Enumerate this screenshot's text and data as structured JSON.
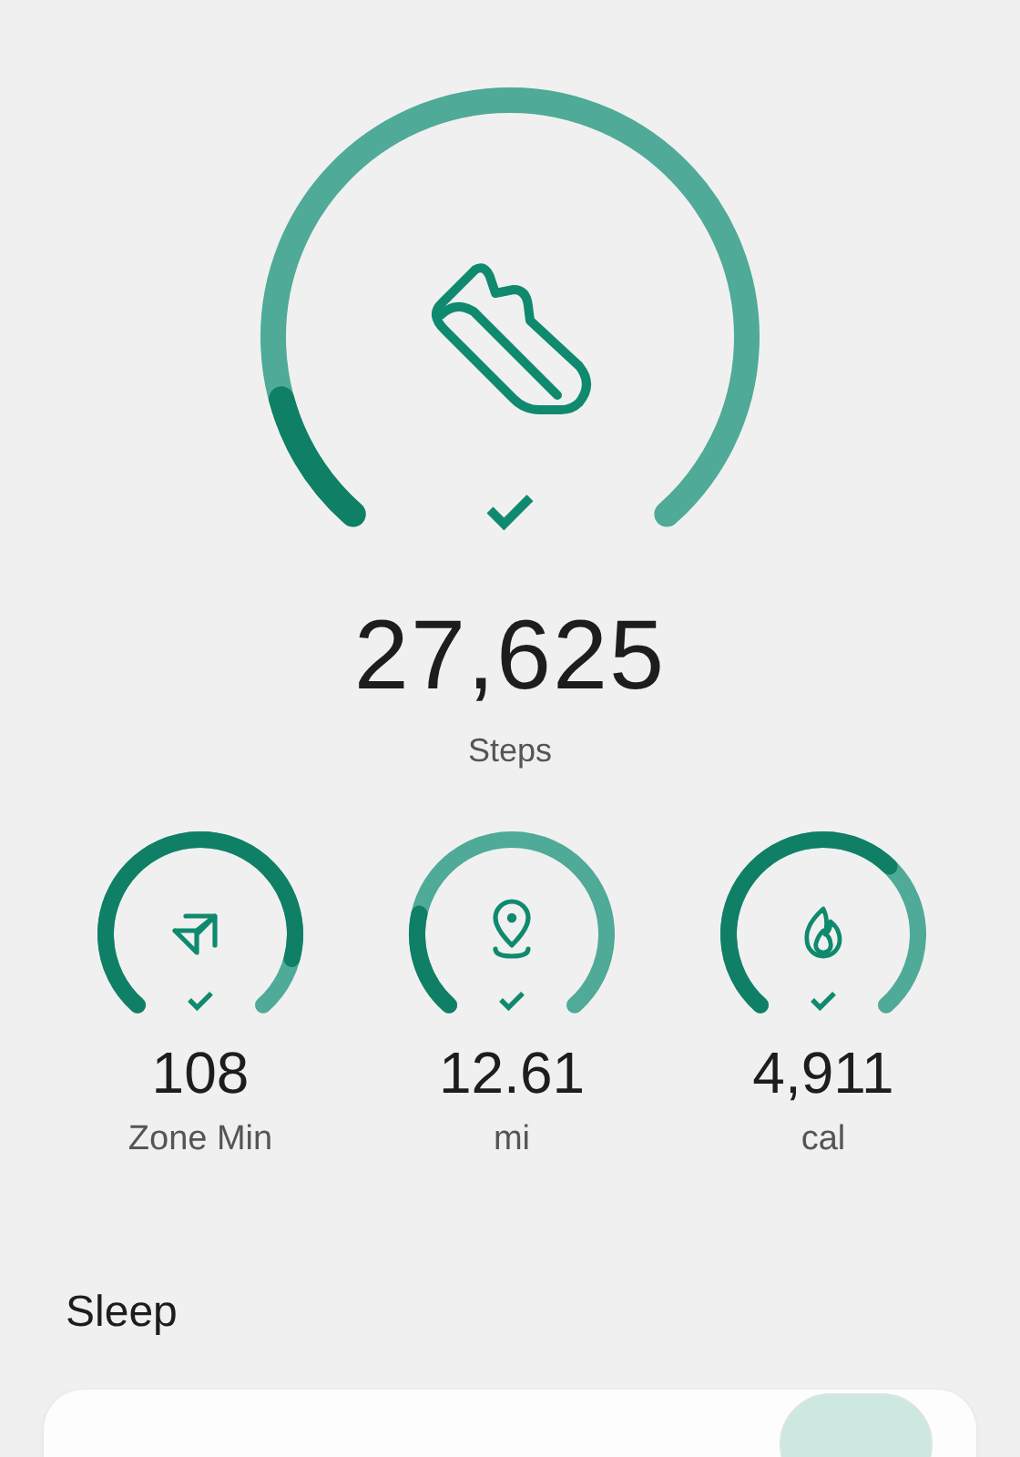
{
  "steps": {
    "goal_met": true,
    "value": "27,625",
    "label": "Steps"
  },
  "metrics": [
    {
      "goal_met": true,
      "value": "108",
      "label": "Zone Min"
    },
    {
      "goal_met": true,
      "value": "12.61",
      "label": "mi"
    },
    {
      "goal_met": true,
      "value": "4,911",
      "label": "cal"
    }
  ],
  "sleep": {
    "title": "Sleep"
  }
}
